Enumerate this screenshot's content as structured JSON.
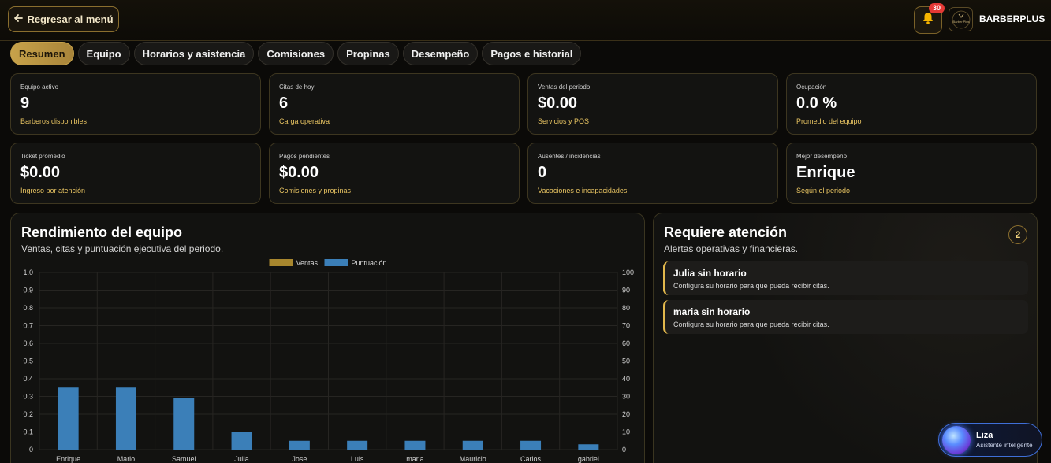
{
  "header": {
    "back_label": "Regresar al menú",
    "notifications_count": "30",
    "brand": "BARBERPLUS",
    "logo_text": "Barber Plus"
  },
  "tabs": [
    {
      "label": "Resumen",
      "active": true
    },
    {
      "label": "Equipo"
    },
    {
      "label": "Horarios y asistencia"
    },
    {
      "label": "Comisiones"
    },
    {
      "label": "Propinas"
    },
    {
      "label": "Desempeño"
    },
    {
      "label": "Pagos e historial"
    }
  ],
  "kpis": [
    {
      "label": "Equipo activo",
      "value": "9",
      "sub": "Barberos disponibles"
    },
    {
      "label": "Citas de hoy",
      "value": "6",
      "sub": "Carga operativa"
    },
    {
      "label": "Ventas del periodo",
      "value": "$0.00",
      "sub": "Servicios y POS"
    },
    {
      "label": "Ocupación",
      "value": "0.0 %",
      "sub": "Promedio del equipo"
    },
    {
      "label": "Ticket promedio",
      "value": "$0.00",
      "sub": "Ingreso por atención"
    },
    {
      "label": "Pagos pendientes",
      "value": "$0.00",
      "sub": "Comisiones y propinas"
    },
    {
      "label": "Ausentes / incidencias",
      "value": "0",
      "sub": "Vacaciones e incapacidades"
    },
    {
      "label": "Mejor desempeño",
      "value": "Enrique",
      "sub": "Según el periodo"
    }
  ],
  "performance": {
    "title": "Rendimiento del equipo",
    "subtitle": "Ventas, citas y puntuación ejecutiva del periodo."
  },
  "alerts": {
    "title": "Requiere atención",
    "subtitle": "Alertas operativas y financieras.",
    "count": "2",
    "items": [
      {
        "title": "Julia sin horario",
        "desc": "Configura su horario para que pueda recibir citas."
      },
      {
        "title": "maria sin horario",
        "desc": "Configura su horario para que pueda recibir citas."
      }
    ]
  },
  "assistant": {
    "name": "Liza",
    "role": "Asistente inteligente"
  },
  "colors": {
    "accent": "#c7a24a",
    "ventas": "#a8872e",
    "puntuacion": "#3b7fb8"
  },
  "chart_data": {
    "type": "bar",
    "categories": [
      "Enrique",
      "Mario",
      "Samuel",
      "Julia",
      "Jose",
      "Luis",
      "maria",
      "Mauricio",
      "Carlos",
      "gabriel"
    ],
    "series": [
      {
        "name": "Ventas",
        "axis": "left",
        "color": "#a8872e",
        "values": [
          0,
          0,
          0,
          0,
          0,
          0,
          0,
          0,
          0,
          0
        ]
      },
      {
        "name": "Puntuación",
        "axis": "right",
        "color": "#3b7fb8",
        "values": [
          35,
          35,
          29,
          10,
          5,
          5,
          5,
          5,
          5,
          3
        ]
      }
    ],
    "y_left": {
      "range": [
        0,
        1.0
      ],
      "ticks": [
        "0",
        "0.1",
        "0.2",
        "0.3",
        "0.4",
        "0.5",
        "0.6",
        "0.7",
        "0.8",
        "0.9",
        "1.0"
      ]
    },
    "y_right": {
      "range": [
        0,
        100
      ],
      "ticks": [
        "0",
        "10",
        "20",
        "30",
        "40",
        "50",
        "60",
        "70",
        "80",
        "90",
        "100"
      ]
    },
    "grid": true,
    "legend": "top-center"
  }
}
